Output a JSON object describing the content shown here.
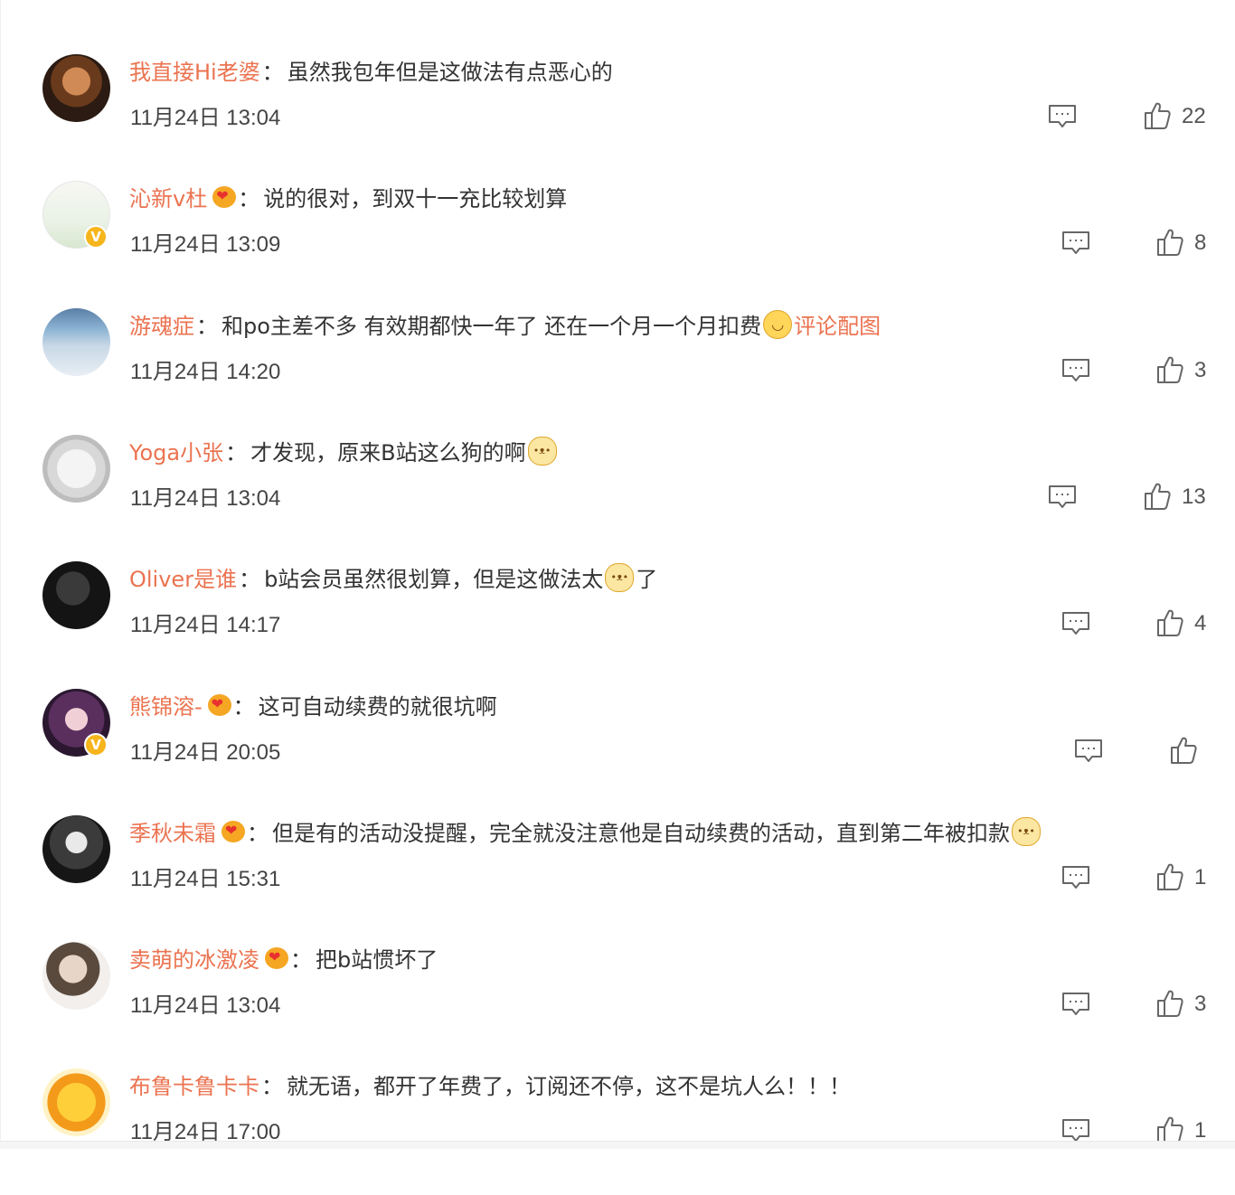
{
  "comments": [
    {
      "username": "我直接Hi老婆",
      "colon": "：",
      "has_vip_badge": false,
      "has_heart_badge": false,
      "segments": [
        {
          "type": "text",
          "value": "虽然我包年但是这做法有点恶心的"
        }
      ],
      "time": "11月24日 13:04",
      "likes": "22"
    },
    {
      "username": "沁新v杜",
      "colon": "：",
      "has_vip_badge": true,
      "has_heart_badge": true,
      "segments": [
        {
          "type": "text",
          "value": "说的很对，到双十一充比较划算"
        }
      ],
      "time": "11月24日 13:09",
      "likes": "8"
    },
    {
      "username": "游魂症",
      "colon": "：",
      "has_vip_badge": false,
      "has_heart_badge": false,
      "segments": [
        {
          "type": "text",
          "value": "和po主差不多 有效期都快一年了 还在一个月一个月扣费"
        },
        {
          "type": "emoji",
          "value": "smile-emoji"
        },
        {
          "type": "link",
          "value": "评论配图"
        }
      ],
      "time": "11月24日 14:20",
      "likes": "3"
    },
    {
      "username": "Yoga小张",
      "colon": "：",
      "has_vip_badge": false,
      "has_heart_badge": false,
      "segments": [
        {
          "type": "text",
          "value": "才发现，原来B站这么狗的啊"
        },
        {
          "type": "emoji",
          "value": "doge-emoji"
        }
      ],
      "time": "11月24日 13:04",
      "likes": "13"
    },
    {
      "username": "Oliver是谁",
      "colon": "：",
      "has_vip_badge": false,
      "has_heart_badge": false,
      "segments": [
        {
          "type": "text",
          "value": "b站会员虽然很划算，但是这做法太"
        },
        {
          "type": "emoji",
          "value": "doge-emoji"
        },
        {
          "type": "text",
          "value": "了"
        }
      ],
      "time": "11月24日 14:17",
      "likes": "4"
    },
    {
      "username": "熊锦溶-",
      "colon": "：",
      "has_vip_badge": true,
      "has_heart_badge": true,
      "segments": [
        {
          "type": "text",
          "value": "这可自动续费的就很坑啊"
        }
      ],
      "time": "11月24日 20:05",
      "likes": ""
    },
    {
      "username": "季秋未霜",
      "colon": "：",
      "has_vip_badge": false,
      "has_heart_badge": true,
      "segments": [
        {
          "type": "text",
          "value": "但是有的活动没提醒，完全就没注意他是自动续费的活动，直到第二年被扣款"
        },
        {
          "type": "emoji",
          "value": "doge-emoji"
        }
      ],
      "time": "11月24日 15:31",
      "likes": "1"
    },
    {
      "username": "卖萌的冰激凌",
      "colon": "：",
      "has_vip_badge": false,
      "has_heart_badge": true,
      "segments": [
        {
          "type": "text",
          "value": "把b站惯坏了"
        }
      ],
      "time": "11月24日 13:04",
      "likes": "3"
    },
    {
      "username": "布鲁卡鲁卡卡",
      "colon": "：",
      "has_vip_badge": false,
      "has_heart_badge": false,
      "segments": [
        {
          "type": "text",
          "value": "就无语，都开了年费了，订阅还不停，这不是坑人么！！！"
        }
      ],
      "time": "11月24日 17:00",
      "likes": "1"
    }
  ],
  "colors": {
    "username": "#eb7350",
    "text": "#333333",
    "time": "#444444",
    "icon": "#666666"
  },
  "icons": {
    "reply": "comment-icon",
    "like": "thumbs-up-icon"
  }
}
